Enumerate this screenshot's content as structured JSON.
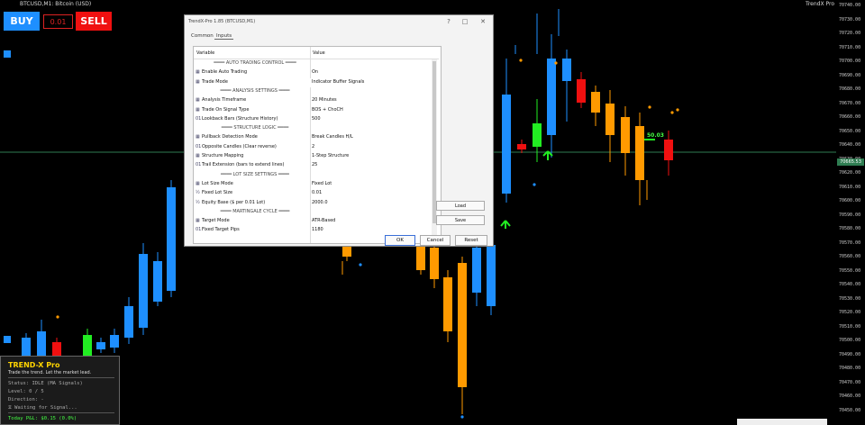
{
  "topbar": {
    "symbol": "BTCUSD,M1: Bitcoin (USD)",
    "indicator": "TrendX Pro"
  },
  "trade_panel": {
    "buy_label": "BUY",
    "sell_label": "SELL",
    "lot_value": "0.01"
  },
  "price_axis": {
    "labels": [
      "70740.00",
      "70730.00",
      "70720.00",
      "70710.00",
      "70700.00",
      "70690.00",
      "70680.00",
      "70670.00",
      "70660.00",
      "70650.00",
      "70640.00",
      "70630.00",
      "70620.00",
      "70610.00",
      "70600.00",
      "70590.00",
      "70580.00",
      "70570.00",
      "70560.00",
      "70550.00",
      "70540.00",
      "70530.00",
      "70520.00",
      "70510.00",
      "70500.00",
      "70490.00",
      "70480.00",
      "70470.00",
      "70460.00",
      "70450.00"
    ],
    "current_label": "70665.53"
  },
  "signal_label": "50.03",
  "info_panel": {
    "title": "TREND-X Pro",
    "tagline": "Trade the trend. Let the market lead.",
    "status": "Status: IDLE (MA Signals)",
    "level": "Level: 0 / 5",
    "direction": "Direction: -",
    "waiting": "⧖ Waiting for Signal...",
    "pnl": "Today P&L: $0.15 (0.0%)"
  },
  "dialog": {
    "title": "TrendX-Pro 1.85 (BTCUSD,M1)",
    "tabs": [
      "Common",
      "Inputs"
    ],
    "active_tab": "Inputs",
    "col_variable": "Variable",
    "col_value": "Value",
    "rows": [
      {
        "icon": "",
        "var": "════ AUTO TRADING CONTROL ════",
        "val": "",
        "section": true
      },
      {
        "icon": "▦",
        "var": "Enable Auto Trading",
        "val": "On"
      },
      {
        "icon": "▦",
        "var": "Trade Mode",
        "val": "Indicator Buffer Signals"
      },
      {
        "icon": "",
        "var": "════ ANALYSIS SETTINGS ════",
        "val": "",
        "section": true
      },
      {
        "icon": "▦",
        "var": "Analysis Timeframe",
        "val": "20 Minutes"
      },
      {
        "icon": "▦",
        "var": "Trade On Signal Type",
        "val": "BOS + ChoCH"
      },
      {
        "icon": "01",
        "var": "Lookback Bars (Structure History)",
        "val": "500"
      },
      {
        "icon": "",
        "var": "════ STRUCTURE LOGIC ════",
        "val": "",
        "section": true
      },
      {
        "icon": "▦",
        "var": "Pullback Detection Mode",
        "val": "Break Candles H/L"
      },
      {
        "icon": "01",
        "var": "Opposite Candles (Clear reverse)",
        "val": "2"
      },
      {
        "icon": "▦",
        "var": "Structure Mapping",
        "val": "1-Step Structure"
      },
      {
        "icon": "01",
        "var": "Trail Extension (bars to extend lines)",
        "val": "25"
      },
      {
        "icon": "",
        "var": "════ LOT SIZE SETTINGS ════",
        "val": "",
        "section": true
      },
      {
        "icon": "▦",
        "var": "Lot Size Mode",
        "val": "Fixed Lot"
      },
      {
        "icon": "½",
        "var": "Fixed Lot Size",
        "val": "0.01"
      },
      {
        "icon": "½",
        "var": "Equity Base ($ per 0.01 Lot)",
        "val": "2000.0"
      },
      {
        "icon": "",
        "var": "════ MARTINGALE CYCLE ════",
        "val": "",
        "section": true
      },
      {
        "icon": "▦",
        "var": "Target Mode",
        "val": "ATR-Based"
      },
      {
        "icon": "01",
        "var": "Fixed Target Pips",
        "val": "1180"
      }
    ],
    "load_label": "Load",
    "save_label": "Save",
    "ok_label": "OK",
    "cancel_label": "Cancel",
    "reset_label": "Reset"
  },
  "colors": {
    "bull": "#1e8fff",
    "bear_strong": "#f01010",
    "bear": "#ff9a00",
    "signal": "#22ee22",
    "annotation": "#e81010",
    "current_price_line": "#2f7d52"
  }
}
